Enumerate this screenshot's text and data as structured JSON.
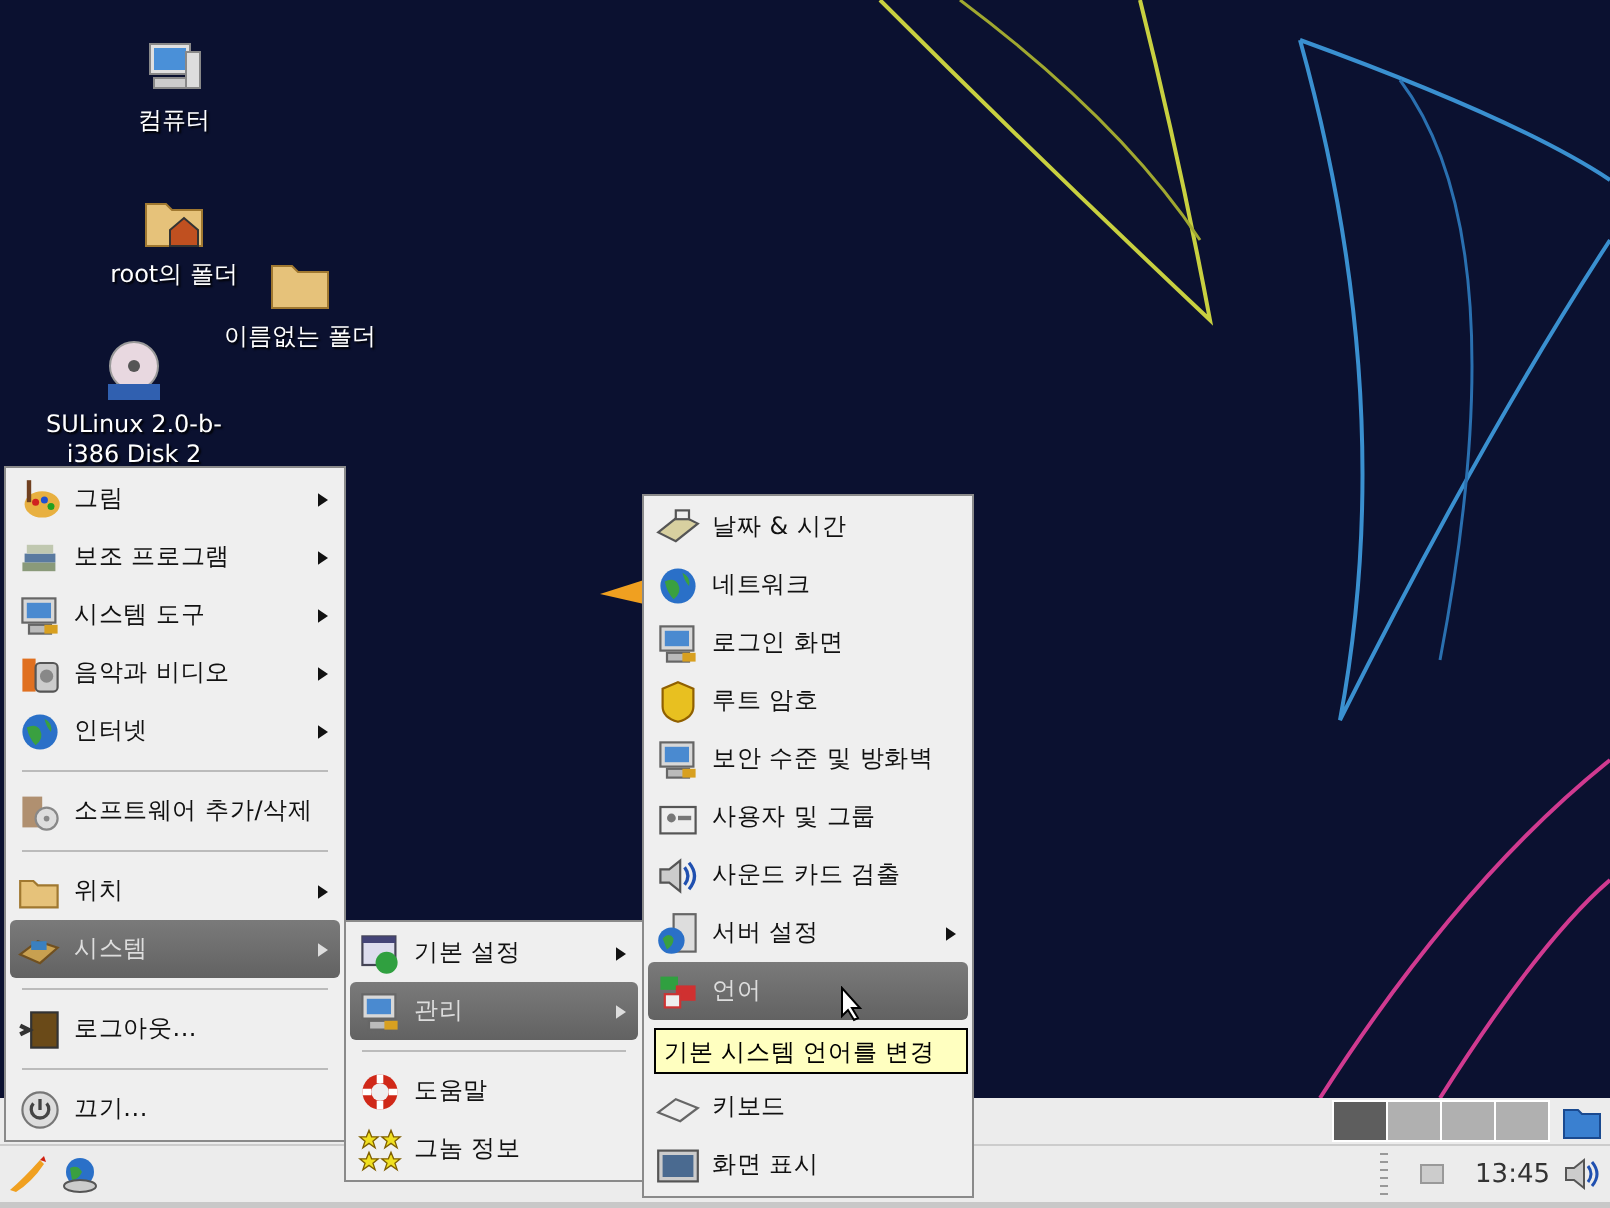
{
  "desktop_icons": [
    {
      "label": "컴퓨터",
      "kind": "computer"
    },
    {
      "label": "root의 폴더",
      "kind": "home"
    },
    {
      "label": "이름없는 폴더",
      "kind": "folder"
    },
    {
      "label": "SULinux 2.0-b-i386 Disk 2",
      "kind": "dvd"
    }
  ],
  "main_menu": {
    "items": [
      {
        "kind": "item",
        "label": "그림",
        "has_submenu": true,
        "selected": false
      },
      {
        "kind": "item",
        "label": "보조 프로그램",
        "has_submenu": true,
        "selected": false
      },
      {
        "kind": "item",
        "label": "시스템 도구",
        "has_submenu": true,
        "selected": false
      },
      {
        "kind": "item",
        "label": "음악과 비디오",
        "has_submenu": true,
        "selected": false
      },
      {
        "kind": "item",
        "label": "인터넷",
        "has_submenu": true,
        "selected": false
      },
      {
        "kind": "separator"
      },
      {
        "kind": "item",
        "label": "소프트웨어 추가/삭제",
        "has_submenu": false,
        "selected": false
      },
      {
        "kind": "separator"
      },
      {
        "kind": "item",
        "label": "위치",
        "has_submenu": true,
        "selected": false
      },
      {
        "kind": "item",
        "label": "시스템",
        "has_submenu": true,
        "selected": true
      },
      {
        "kind": "separator"
      },
      {
        "kind": "item",
        "label": "로그아웃...",
        "has_submenu": false,
        "selected": false
      },
      {
        "kind": "separator"
      },
      {
        "kind": "item",
        "label": "끄기...",
        "has_submenu": false,
        "selected": false
      }
    ]
  },
  "system_menu": {
    "items": [
      {
        "kind": "item",
        "label": "기본 설정",
        "has_submenu": true,
        "selected": false
      },
      {
        "kind": "item",
        "label": "관리",
        "has_submenu": true,
        "selected": true
      },
      {
        "kind": "separator"
      },
      {
        "kind": "item",
        "label": "도움말",
        "has_submenu": false,
        "selected": false
      },
      {
        "kind": "item",
        "label": "그놈 정보",
        "has_submenu": false,
        "selected": false
      }
    ]
  },
  "admin_menu": {
    "items": [
      {
        "kind": "item",
        "label": "날짜 & 시간",
        "has_submenu": false,
        "selected": false
      },
      {
        "kind": "item",
        "label": "네트워크",
        "has_submenu": false,
        "selected": false
      },
      {
        "kind": "item",
        "label": "로그인 화면",
        "has_submenu": false,
        "selected": false
      },
      {
        "kind": "item",
        "label": "루트 암호",
        "has_submenu": false,
        "selected": false
      },
      {
        "kind": "item",
        "label": "보안 수준 및 방화벽",
        "has_submenu": false,
        "selected": false
      },
      {
        "kind": "item",
        "label": "사용자 및 그룹",
        "has_submenu": false,
        "selected": false
      },
      {
        "kind": "item",
        "label": "사운드 카드 검출",
        "has_submenu": false,
        "selected": false
      },
      {
        "kind": "item",
        "label": "서버 설정",
        "has_submenu": true,
        "selected": false
      },
      {
        "kind": "item",
        "label": "언어",
        "has_submenu": false,
        "selected": true
      },
      {
        "kind": "covered"
      },
      {
        "kind": "item",
        "label": "키보드",
        "has_submenu": false,
        "selected": false
      },
      {
        "kind": "item",
        "label": "화면 표시",
        "has_submenu": false,
        "selected": false
      }
    ]
  },
  "tooltip": "기본 시스템 언어를 변경",
  "panel": {
    "workspaces": [
      {
        "selected": true
      },
      {
        "selected": false
      },
      {
        "selected": false
      },
      {
        "selected": false
      }
    ],
    "clock": "13:45"
  }
}
